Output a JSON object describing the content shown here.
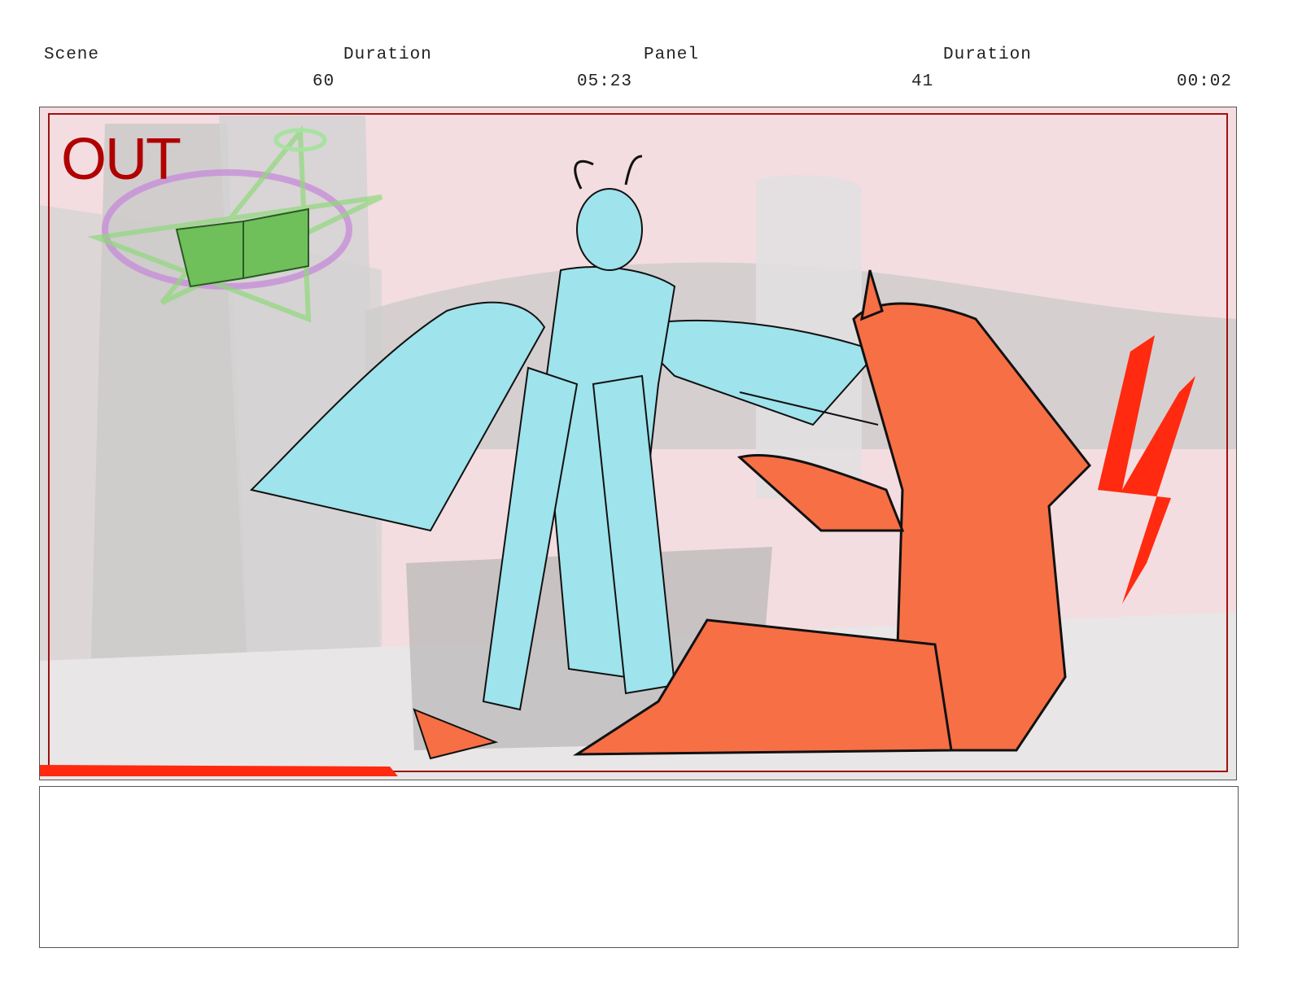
{
  "header": {
    "scene_label": "Scene",
    "scene_duration_label": "Duration",
    "panel_label": "Panel",
    "panel_duration_label": "Duration",
    "scene_number": "60",
    "scene_duration": "05:23",
    "panel_number": "41",
    "panel_duration": "00:02"
  },
  "panel": {
    "annotation": "OUT"
  },
  "notes": {
    "text": ""
  },
  "colors": {
    "background_tint": "#f3d9dc",
    "demon_cyan": "#9fe3ec",
    "figure_orange": "#f76f45",
    "blood_red": "#ff2a10",
    "book_green": "#6fbf5b",
    "out_red": "#b00000"
  }
}
